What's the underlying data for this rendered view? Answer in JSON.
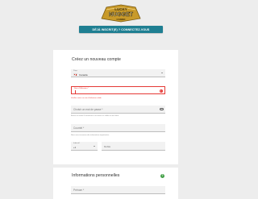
{
  "logo": {
    "line1": "LUCKY",
    "line2": "NUGGET",
    "line3": "CASINO"
  },
  "header": {
    "login_button": "DÉJÀ INSCRIT(E) ? CONNECTEZ-VOUS"
  },
  "form": {
    "title": "Créez un nouveau compte",
    "country": {
      "label": "Pays",
      "value": "Canada",
      "flag_icon": "canada-flag-icon"
    },
    "username": {
      "label": "Nom d'Utilisateur *",
      "value": "",
      "error": "Veuillez entrer un nom d'utilisateur valide"
    },
    "password": {
      "placeholder": "Choisir un mot de passe *",
      "help": "Entrez au moins 8 caractères et au moins un chiffre et une lettre."
    },
    "email": {
      "placeholder": "Courriel *",
      "help": "Nous vous enverrons des informations importantes."
    },
    "phone": {
      "code_label": "Indicatif",
      "code_value": "+1",
      "number_placeholder": "Mobile"
    }
  },
  "personal": {
    "title": "Informations personnelles",
    "first_name_placeholder": "Prénom *"
  },
  "colors": {
    "accent": "#1f7f92",
    "error": "#e53935",
    "info": "#43a047"
  }
}
